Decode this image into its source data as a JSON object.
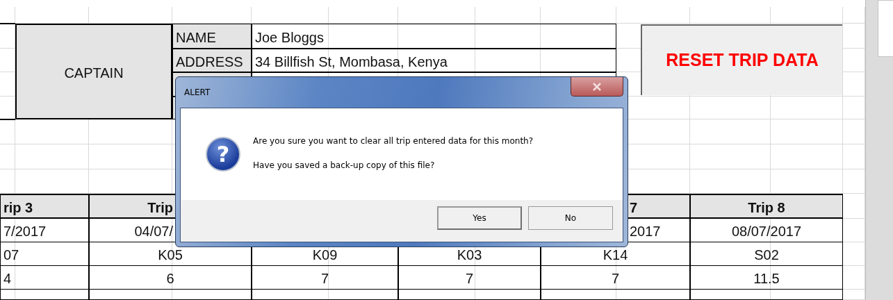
{
  "captain_block": {
    "label": "CAPTAIN",
    "fields": [
      {
        "label": "NAME",
        "value": "Joe Bloggs"
      },
      {
        "label": "ADDRESS",
        "value": "34 Billfish St, Mombasa, Kenya"
      }
    ]
  },
  "reset_button": {
    "label": "RESET TRIP DATA"
  },
  "trips_table": {
    "columns": [
      {
        "header": "rip 3"
      },
      {
        "header": "Trip"
      },
      {},
      {},
      {
        "header": "7"
      },
      {
        "header": "Trip 8"
      }
    ],
    "rows": [
      {
        "cells": [
          "7/2017",
          "04/07/",
          null,
          null,
          "2017",
          "08/07/2017"
        ]
      },
      {
        "cells": [
          "07",
          "K05",
          "K09",
          "K03",
          "K14",
          "S02"
        ]
      },
      {
        "cells": [
          "4",
          "6",
          "7",
          "7",
          "7",
          "11.5"
        ]
      }
    ]
  },
  "dialog": {
    "title": "ALERT",
    "icon_glyph": "?",
    "messages": [
      "Are you sure you want to clear all trip entered data for this month?",
      "Have you saved a back-up copy of this file?"
    ],
    "buttons": [
      {
        "label": "Yes",
        "default": true
      },
      {
        "label": "No",
        "default": false
      }
    ]
  }
}
